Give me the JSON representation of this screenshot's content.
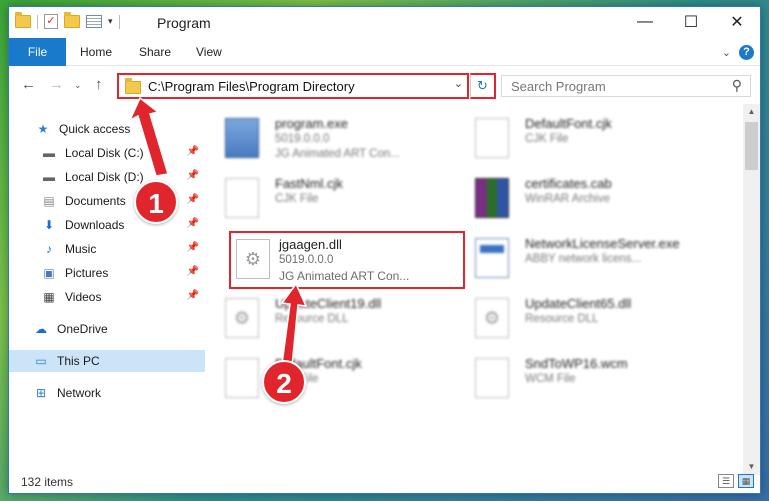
{
  "window": {
    "title": "Program"
  },
  "ribbon": {
    "tabs": [
      "File",
      "Home",
      "Share",
      "View"
    ]
  },
  "address": {
    "path": "C:\\Program Files\\Program Directory"
  },
  "search": {
    "placeholder": "Search Program"
  },
  "nav": {
    "items": [
      {
        "label": "Quick access",
        "icon": "star-icon",
        "pinned": false
      },
      {
        "label": "Local Disk (C:)",
        "icon": "drive-icon",
        "pinned": true
      },
      {
        "label": "Local Disk (D:)",
        "icon": "drive-icon",
        "pinned": true
      },
      {
        "label": "Documents",
        "icon": "documents-icon",
        "pinned": true
      },
      {
        "label": "Downloads",
        "icon": "download-icon",
        "pinned": true
      },
      {
        "label": "Music",
        "icon": "music-icon",
        "pinned": true
      },
      {
        "label": "Pictures",
        "icon": "pictures-icon",
        "pinned": true
      },
      {
        "label": "Videos",
        "icon": "videos-icon",
        "pinned": true
      },
      {
        "label": "OneDrive",
        "icon": "cloud-icon",
        "pinned": false
      },
      {
        "label": "This PC",
        "icon": "pc-icon",
        "pinned": false,
        "selected": true
      },
      {
        "label": "Network",
        "icon": "network-icon",
        "pinned": false
      }
    ]
  },
  "files": [
    {
      "name": "program.exe",
      "line2": "5019.0.0.0",
      "line3": "JG Animated ART Con...",
      "icon": "exe-icon"
    },
    {
      "name": "DefaultFont.cjk",
      "line2": "CJK File",
      "line3": "",
      "icon": "document-icon"
    },
    {
      "name": "FastNml.cjk",
      "line2": "CJK File",
      "line3": "",
      "icon": "document-icon"
    },
    {
      "name": "certificates.cab",
      "line2": "WinRAR Archive",
      "line3": "",
      "icon": "rar-icon"
    },
    {
      "name": "jgaagen.dll",
      "line2": "5019.0.0.0",
      "line3": "JG Animated ART Con...",
      "icon": "dll-icon",
      "highlighted": true
    },
    {
      "name": "NetworkLicenseServer.exe",
      "line2": "ABBY network licens...",
      "line3": "",
      "icon": "app-icon"
    },
    {
      "name": "UpdateClient19.dll",
      "line2": "Resource DLL",
      "line3": "",
      "icon": "dll-icon"
    },
    {
      "name": "UpdateClient65.dll",
      "line2": "Resource DLL",
      "line3": "",
      "icon": "dll-icon"
    },
    {
      "name": "DefaultFont.cjk",
      "line2": "CJK File",
      "line3": "",
      "icon": "document-icon"
    },
    {
      "name": "SndToWP16.wcm",
      "line2": "WCM File",
      "line3": "",
      "icon": "document-icon"
    }
  ],
  "status": {
    "count": "132 items"
  },
  "annotations": {
    "badge1": "1",
    "badge2": "2"
  },
  "colors": {
    "accent": "#1979ca",
    "highlight": "#e0262c"
  }
}
